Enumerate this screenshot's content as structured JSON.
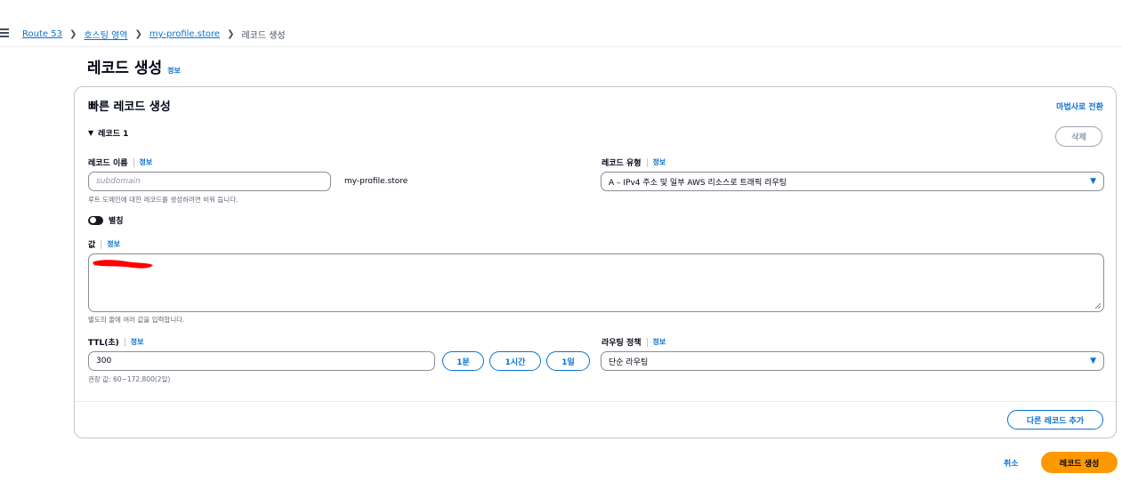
{
  "breadcrumb": {
    "items": [
      "Route 53",
      "호스팅 영역",
      "my-profile.store"
    ],
    "current": "레코드 생성"
  },
  "page": {
    "title": "레코드 생성",
    "info": "정보"
  },
  "card": {
    "title": "빠른 레코드 생성",
    "wizard_link": "마법사로 전환",
    "record_label": "레코드 1",
    "delete_label": "삭제"
  },
  "record_name": {
    "label": "레코드 이름",
    "info": "정보",
    "placeholder": "subdomain",
    "suffix": "my-profile.store",
    "hint": "루트 도메인에 대한 레코드를 생성하려면 비워 둡니다."
  },
  "record_type": {
    "label": "레코드 유형",
    "info": "정보",
    "value": "A – IPv4 주소 및 일부 AWS 리소스로 트래픽 라우팅"
  },
  "alias": {
    "label": "별칭",
    "enabled": false
  },
  "value_field": {
    "label": "값",
    "info": "정보",
    "hint": "별도의 줄에 여러 값을 입력합니다."
  },
  "ttl": {
    "label": "TTL(초)",
    "info": "정보",
    "value": "300",
    "buttons": [
      "1분",
      "1시간",
      "1일"
    ],
    "hint": "권장 값: 60~172,800(2일)"
  },
  "routing": {
    "label": "라우팅 정책",
    "info": "정보",
    "value": "단순 라우팅"
  },
  "footer": {
    "add_record": "다른 레코드 추가",
    "cancel": "취소",
    "submit": "레코드 생성"
  },
  "colors": {
    "link": "#0972d3",
    "primary_button": "#ff9900",
    "redaction": "#ff0000"
  }
}
